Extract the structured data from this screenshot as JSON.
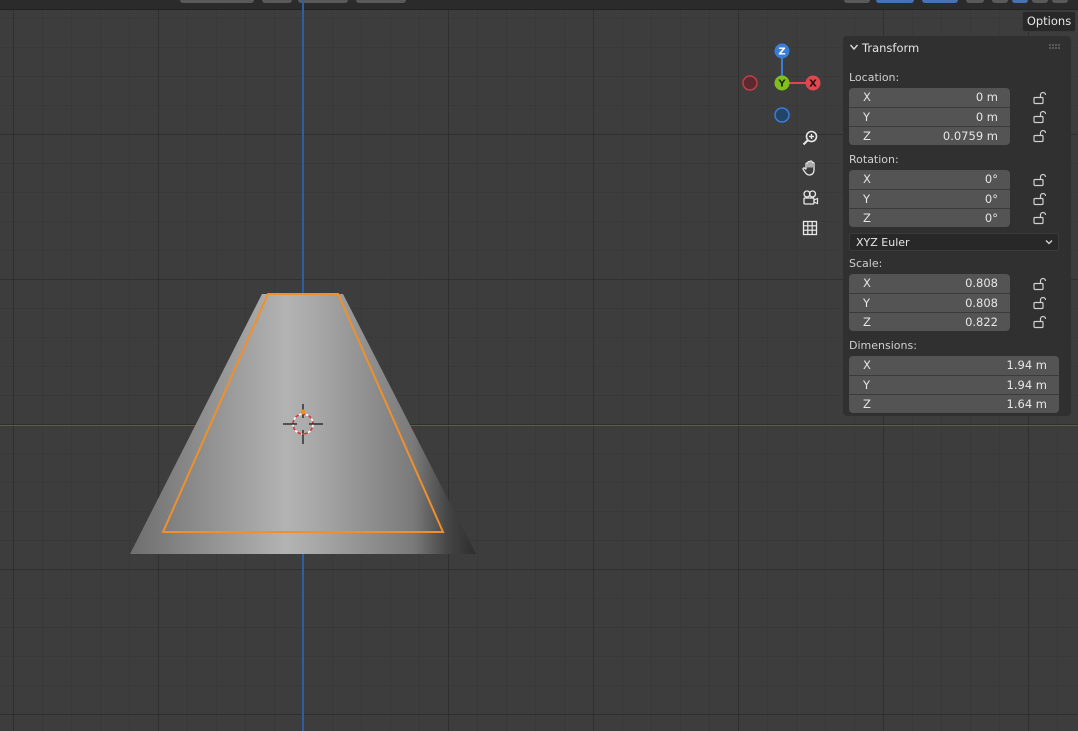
{
  "header": {
    "options_label": "Options"
  },
  "gizmo": {
    "z_label": "Z",
    "y_label": "Y",
    "x_label": "X"
  },
  "colors": {
    "x_axis": "#e0474f",
    "y_axis": "#7fbf1e",
    "z_axis": "#3a7dd6",
    "selection_outline": "#f08f2c",
    "viewport_bg": "#3d3d3d"
  },
  "transform": {
    "title": "Transform",
    "location": {
      "label": "Location:",
      "x": {
        "axis": "X",
        "value": "0 m"
      },
      "y": {
        "axis": "Y",
        "value": "0 m"
      },
      "z": {
        "axis": "Z",
        "value": "0.0759 m"
      }
    },
    "rotation": {
      "label": "Rotation:",
      "x": {
        "axis": "X",
        "value": "0°"
      },
      "y": {
        "axis": "Y",
        "value": "0°"
      },
      "z": {
        "axis": "Z",
        "value": "0°"
      },
      "mode": "XYZ Euler"
    },
    "scale": {
      "label": "Scale:",
      "x": {
        "axis": "X",
        "value": "0.808"
      },
      "y": {
        "axis": "Y",
        "value": "0.808"
      },
      "z": {
        "axis": "Z",
        "value": "0.822"
      }
    },
    "dimensions": {
      "label": "Dimensions:",
      "x": {
        "axis": "X",
        "value": "1.94 m"
      },
      "y": {
        "axis": "Y",
        "value": "1.94 m"
      },
      "z": {
        "axis": "Z",
        "value": "1.64 m"
      }
    }
  },
  "icons": {
    "zoom": "zoom-icon",
    "pan": "hand-icon",
    "camera": "camera-icon",
    "grid": "grid-icon",
    "lock": "unlocked-icon",
    "chevron": "chevron-down-icon"
  }
}
